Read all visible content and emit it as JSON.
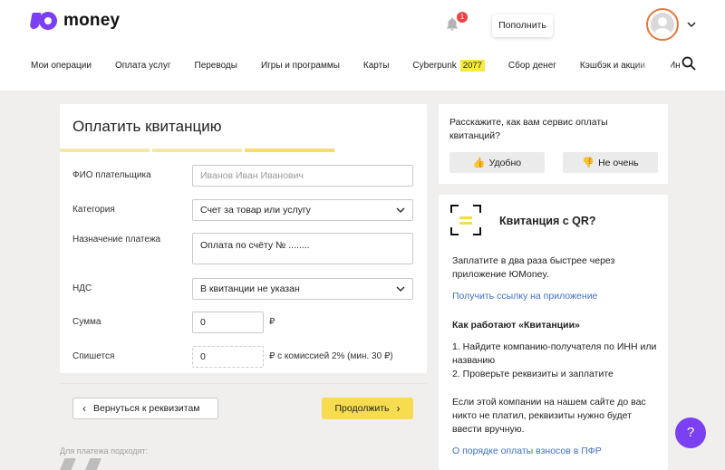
{
  "header": {
    "logo_text": "money",
    "notification_count": "1",
    "topup_label": "Пополнить",
    "nav": [
      {
        "label": "Мои операции"
      },
      {
        "label": "Оплата услуг"
      },
      {
        "label": "Переводы"
      },
      {
        "label": "Игры и программы"
      },
      {
        "label": "Карты"
      },
      {
        "label": "Cyberpunk",
        "badge": "2077"
      },
      {
        "label": "Сбор денег"
      },
      {
        "label": "Кэшбэк и акции"
      },
      {
        "label": "Ин"
      }
    ]
  },
  "form": {
    "title": "Оплатить квитанцию",
    "payer_label": "ФИО плательщика",
    "payer_placeholder": "Иванов Иван Иванович",
    "category_label": "Категория",
    "category_value": "Счет за товар или услугу",
    "purpose_label": "Назначение платежа",
    "purpose_value": "Оплата по счёту № ........",
    "vat_label": "НДС",
    "vat_value": "В квитанции не указан",
    "sum_label": "Сумма",
    "sum_value": "0",
    "sum_currency": "₽",
    "charge_label": "Спишется",
    "charge_value": "0",
    "charge_note": "₽ с комиссией 2% (мин. 30 ₽)",
    "back_label": "Вернуться к реквизитам",
    "next_label": "Продолжить"
  },
  "payment_note": "Для платежа подходят:",
  "feedback": {
    "question": "Расскажите, как вам сервис оплаты квитанций?",
    "good_label": "Удобно",
    "bad_label": "Не очень"
  },
  "qr": {
    "title": "Квитанция с QR?",
    "text": "Заплатите в два раза быстрее через приложение ЮMoney.",
    "link": "Получить ссылку на приложение",
    "how_title": "Как работают «Квитанции»",
    "step1": "1. Найдите компанию-получателя по ИНН или названию",
    "step2": "2. Проверьте реквизиты и заплатите",
    "info": "Если этой компании на нашем сайте до вас никто не платил, реквизиты нужно будет ввести вручную.",
    "pfr_link": "О порядке оплаты взносов в ПФР"
  },
  "help_label": "?",
  "colors": {
    "brand_purple": "#7b40f2",
    "accent_yellow": "#f6dc4e",
    "link_blue": "#3f70c7",
    "avatar_ring": "#e8773b"
  }
}
